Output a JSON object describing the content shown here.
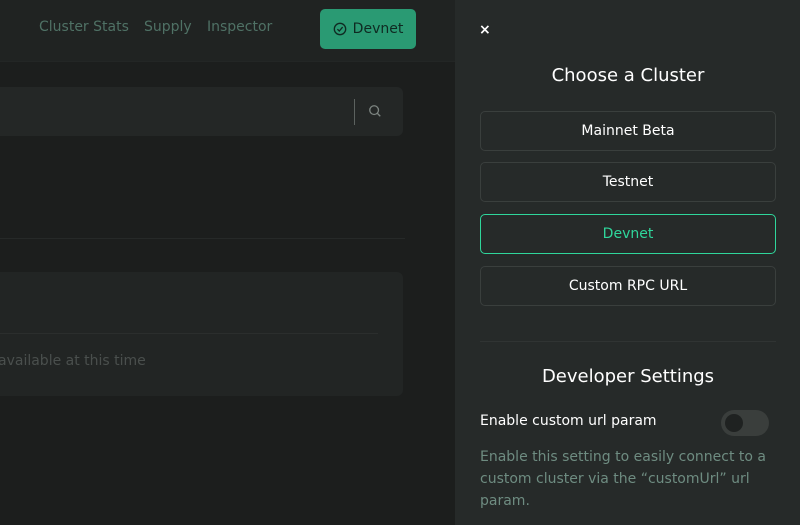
{
  "nav": {
    "links": [
      "Cluster Stats",
      "Supply",
      "Inspector"
    ],
    "cluster_button_label": "Devnet"
  },
  "main": {
    "card_text": "available at this time"
  },
  "panel": {
    "close_label": "×",
    "title": "Choose a Cluster",
    "clusters": [
      {
        "label": "Mainnet Beta",
        "active": false
      },
      {
        "label": "Testnet",
        "active": false
      },
      {
        "label": "Devnet",
        "active": true
      },
      {
        "label": "Custom RPC URL",
        "active": false
      }
    ],
    "developer_title": "Developer Settings",
    "setting_label": "Enable custom url param",
    "setting_enabled": false,
    "setting_description": "Enable this setting to easily connect to a custom cluster via the “customUrl” url param."
  },
  "colors": {
    "accent": "#2fd69b",
    "button_fill": "#2a9a73"
  }
}
